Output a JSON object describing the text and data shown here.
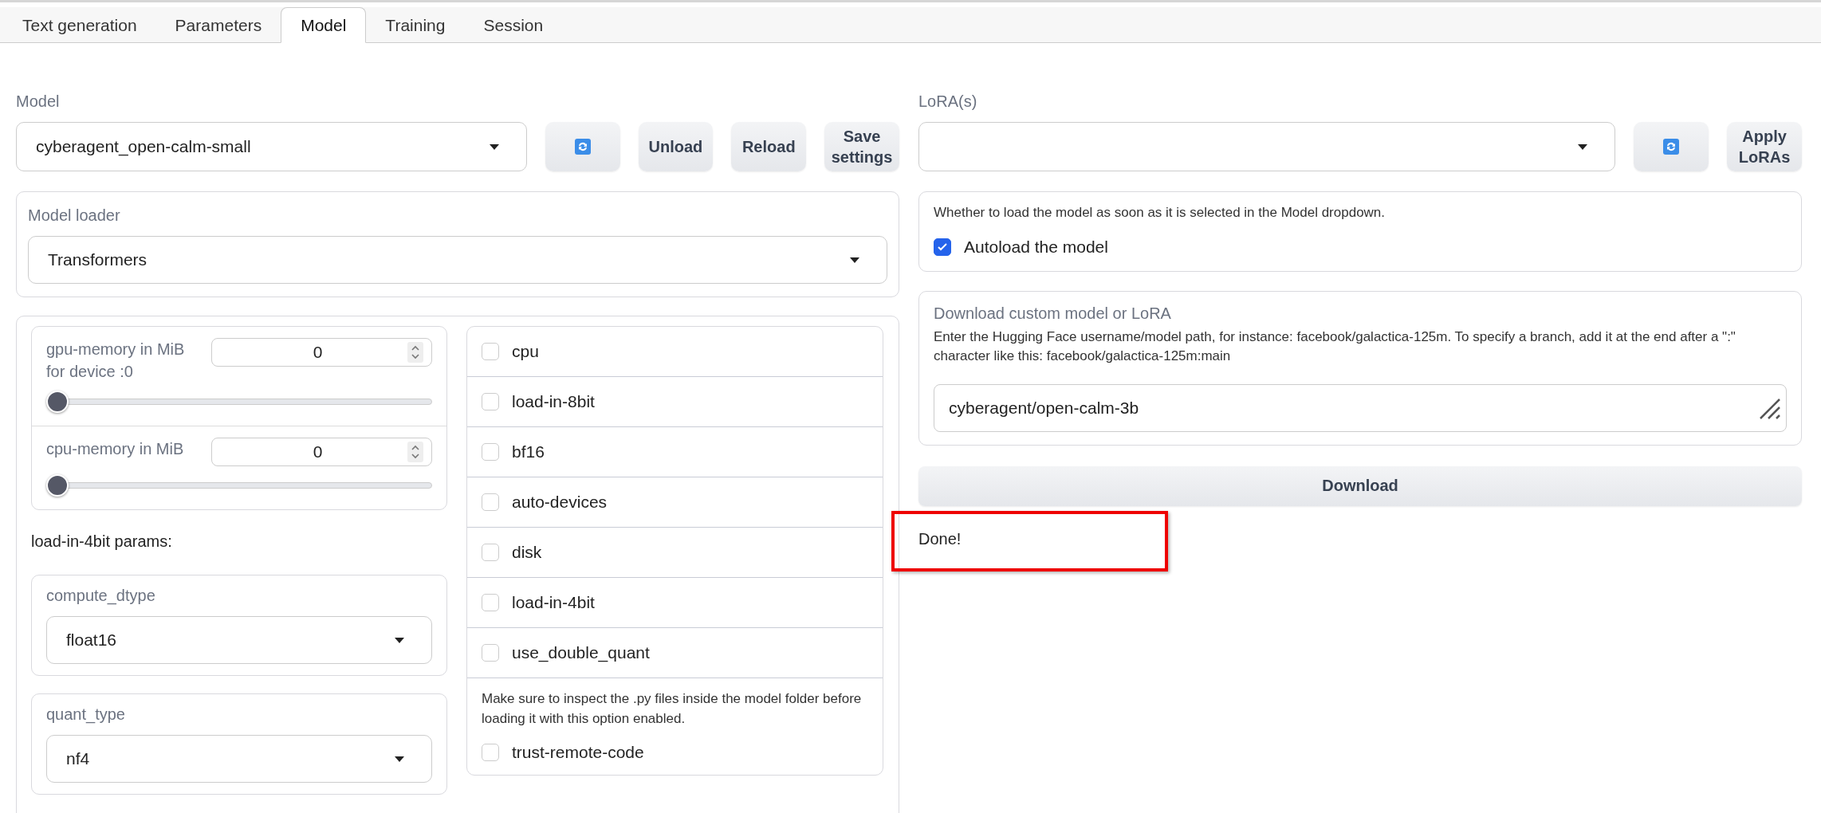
{
  "tabs": [
    {
      "label": "Text generation",
      "selected": false
    },
    {
      "label": "Parameters",
      "selected": false
    },
    {
      "label": "Model",
      "selected": true
    },
    {
      "label": "Training",
      "selected": false
    },
    {
      "label": "Session",
      "selected": false
    }
  ],
  "model": {
    "label": "Model",
    "value": "cyberagent_open-calm-small"
  },
  "model_buttons": [
    {
      "kind": "refresh"
    },
    {
      "kind": "text",
      "label": "Unload"
    },
    {
      "kind": "text",
      "label": "Reload"
    },
    {
      "kind": "text",
      "label": "Save settings"
    }
  ],
  "loader": {
    "label": "Model loader",
    "value": "Transformers"
  },
  "memory": [
    {
      "label": "gpu-memory in MiB for device :0",
      "value": "0",
      "level": 0
    },
    {
      "label": "cpu-memory in MiB",
      "value": "0",
      "level": 0
    }
  ],
  "four_bit": {
    "heading": "load-in-4bit params:",
    "selects": [
      {
        "label": "compute_dtype",
        "value": "float16"
      },
      {
        "label": "quant_type",
        "value": "nf4"
      }
    ]
  },
  "flags": [
    {
      "label": "cpu",
      "checked": false
    },
    {
      "label": "load-in-8bit",
      "checked": false
    },
    {
      "label": "bf16",
      "checked": false
    },
    {
      "label": "auto-devices",
      "checked": false
    },
    {
      "label": "disk",
      "checked": false
    },
    {
      "label": "load-in-4bit",
      "checked": false
    },
    {
      "label": "use_double_quant",
      "checked": false
    }
  ],
  "trust": {
    "note": "Make sure to inspect the .py files inside the model folder before loading it with this option enabled.",
    "label": "trust-remote-code",
    "checked": false
  },
  "lora": {
    "label": "LoRA(s)"
  },
  "lora_buttons": [
    {
      "kind": "refresh"
    },
    {
      "kind": "text",
      "label": "Apply LoRAs"
    }
  ],
  "autoload": {
    "description": "Whether to load the model as soon as it is selected in the Model dropdown.",
    "label": "Autoload the model",
    "checked": true
  },
  "download": {
    "title": "Download custom model or LoRA",
    "description": "Enter the Hugging Face username/model path, for instance: facebook/galactica-125m. To specify a branch, add it at the end after a \":\" character like this: facebook/galactica-125m:main",
    "value": "cyberagent/open-calm-3b",
    "button": "Download"
  },
  "status": {
    "text": "Done!",
    "highlighted": true
  }
}
